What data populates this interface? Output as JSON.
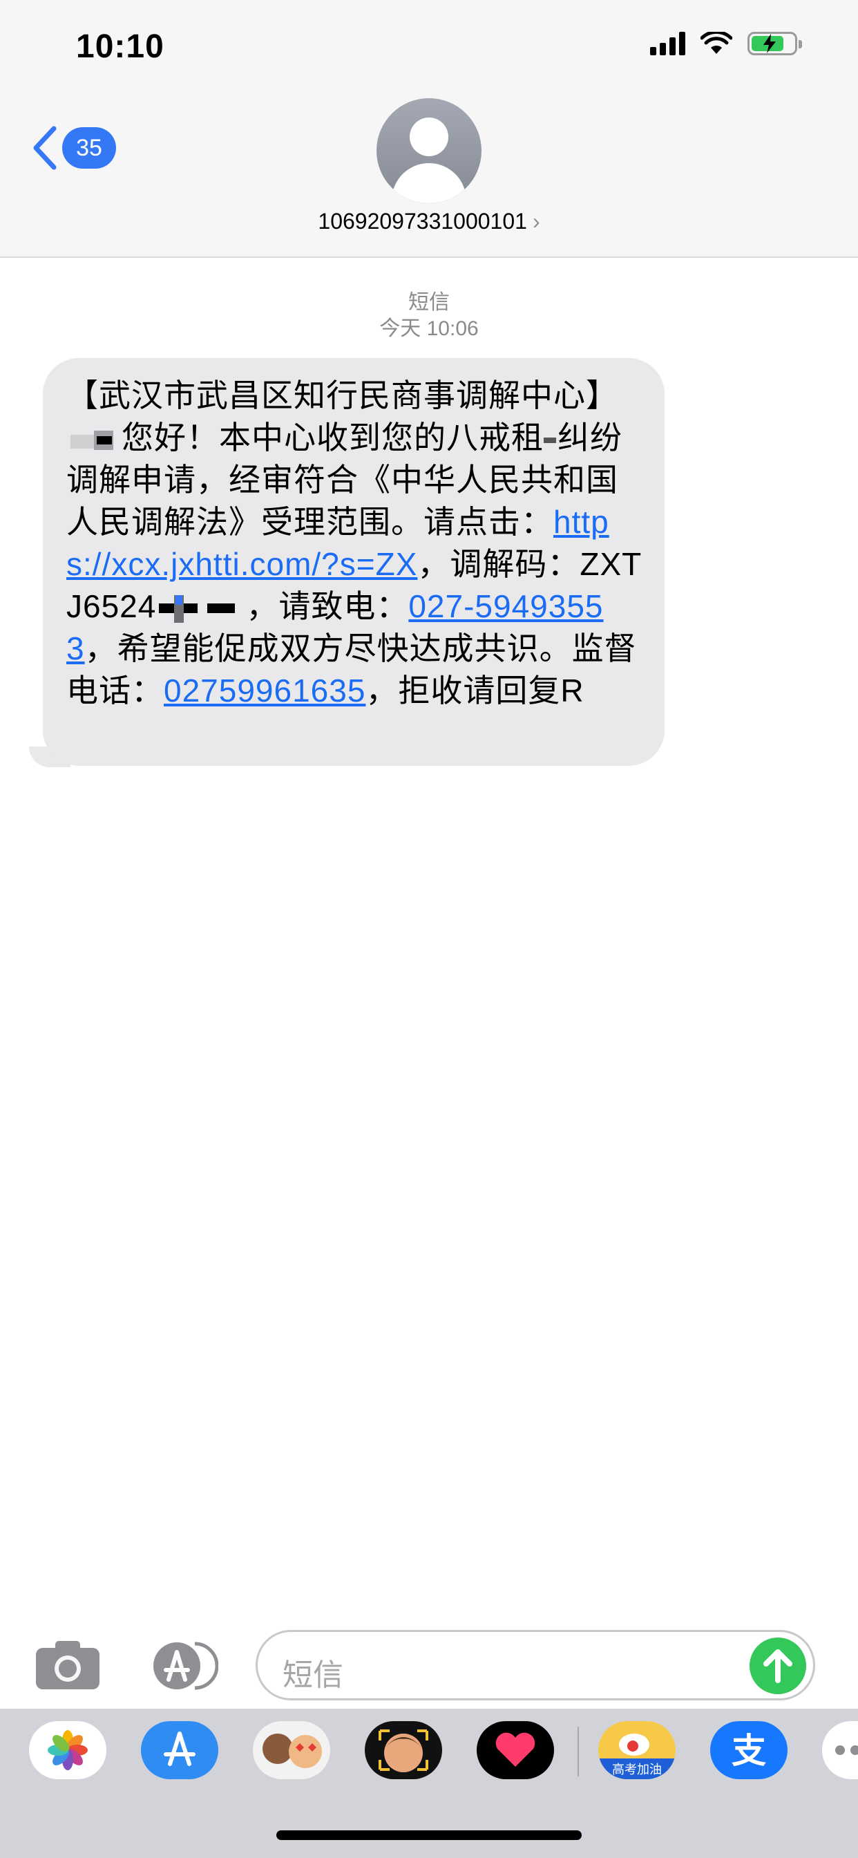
{
  "status": {
    "time": "10:10"
  },
  "header": {
    "back_count": "35",
    "contact": "10692097331000101",
    "contact_chevron": "›"
  },
  "conversation": {
    "service": "短信",
    "timestamp": "今天 10:06",
    "message": {
      "p1": "【武汉市武昌区知行民商事调解中心】",
      "p2": "您好！本中心收到您的八戒租",
      "p3": "纠纷调解申请，经审符合《中华人民共和国人民调解法》受理范围。请点击：",
      "link_url": "https://xcx.jxhtti.com/?s=ZX",
      "p4": "，调解码：ZXTJ6524",
      "p5": "，请致电：",
      "phone1": "027-59493553",
      "p6": "，希望能促成双方尽快达成共识。监督电话：",
      "phone2": "02759961635",
      "p7": "，拒收请回复R"
    }
  },
  "input": {
    "placeholder": "短信"
  },
  "drawer": {
    "apps": [
      "photos-icon",
      "app-store-icon",
      "memoji-stickers-icon",
      "memoji-icon",
      "digital-touch-icon",
      "weibo-icon",
      "alipay-icon",
      "more-icon"
    ],
    "weibo_caption": "高考加油",
    "alipay_glyph": "支"
  },
  "colors": {
    "accent": "#3478f6",
    "link": "#1a6cf5",
    "bubble": "#e9e9eb",
    "send": "#34c759"
  }
}
